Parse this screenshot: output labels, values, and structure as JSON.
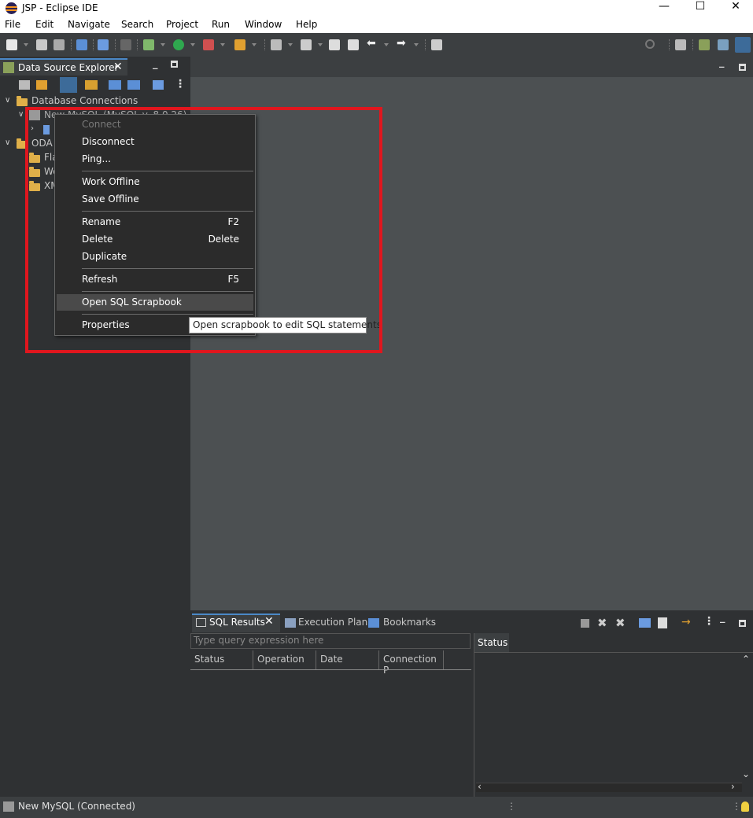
{
  "window": {
    "title": "JSP - Eclipse IDE",
    "minimize": "—",
    "maximize": "☐",
    "close": "✕"
  },
  "menubar": [
    "File",
    "Edit",
    "Navigate",
    "Search",
    "Project",
    "Run",
    "Window",
    "Help"
  ],
  "left_panel": {
    "tab_label": "Data Source Explorer",
    "tab_close": "✕",
    "minimize": "▬",
    "maximize": "▪",
    "tree": {
      "root": "Database Connections",
      "connection": "New MySQL (MySQL v. 8.0.26)",
      "oda": "ODA",
      "oda_children": [
        "Fla",
        "We",
        "XM"
      ]
    }
  },
  "context_menu": {
    "items": [
      {
        "label": "Connect",
        "accel": "",
        "disabled": true
      },
      {
        "label": "Disconnect",
        "accel": ""
      },
      {
        "label": "Ping...",
        "accel": ""
      },
      {
        "label": "Work Offline",
        "accel": ""
      },
      {
        "label": "Save Offline",
        "accel": ""
      },
      {
        "label": "Rename",
        "accel": "F2"
      },
      {
        "label": "Delete",
        "accel": "Delete"
      },
      {
        "label": "Duplicate",
        "accel": ""
      },
      {
        "label": "Refresh",
        "accel": "F5"
      },
      {
        "label": "Open SQL Scrapbook",
        "accel": "",
        "hover": true
      },
      {
        "label": "Properties",
        "accel": ""
      }
    ]
  },
  "tooltip": "Open scrapbook to edit SQL statements",
  "bottom_panel": {
    "tabs": [
      "SQL Results",
      "Execution Plan",
      "Bookmarks"
    ],
    "active_tab_close": "✕",
    "query_placeholder": "Type query expression here",
    "columns": [
      "Status",
      "Operation",
      "Date",
      "Connection P"
    ],
    "status_tab": "Status"
  },
  "statusbar": {
    "text": "New MySQL (Connected)"
  },
  "colors": {
    "highlight": "#e0161e",
    "accent": "#4a88c7"
  }
}
